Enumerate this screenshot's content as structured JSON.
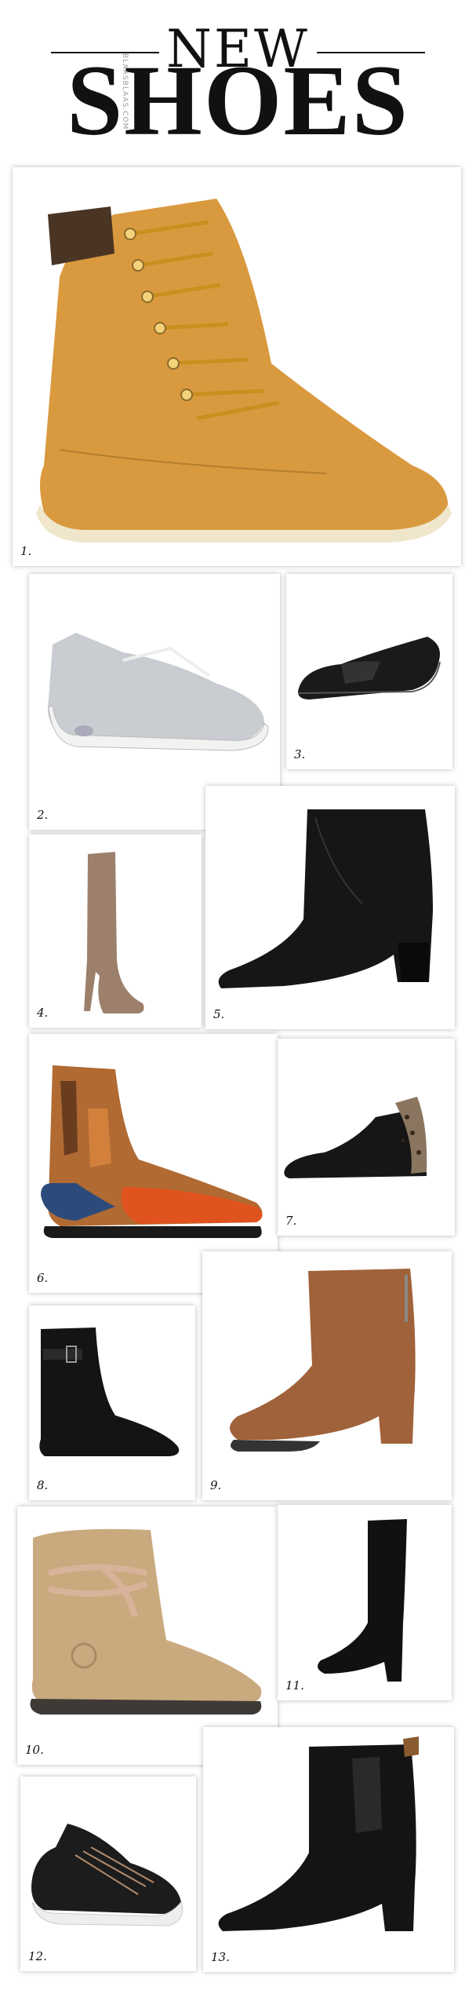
{
  "header": {
    "line1": "NEW",
    "line2": "SHOES",
    "vertical_text": "BLAASBLAAS.COM"
  },
  "items": [
    {
      "label": "1.",
      "icon": "tan-lace-up-ankle-boot-icon"
    },
    {
      "label": "2.",
      "icon": "silver-sneaker-icon"
    },
    {
      "label": "3.",
      "icon": "black-loafer-icon"
    },
    {
      "label": "4.",
      "icon": "taupe-over-knee-boot-icon"
    },
    {
      "label": "5.",
      "icon": "black-heeled-ankle-boot-icon"
    },
    {
      "label": "6.",
      "icon": "brogue-chelsea-boot-icon"
    },
    {
      "label": "7.",
      "icon": "leopard-chelsea-boot-icon"
    },
    {
      "label": "8.",
      "icon": "black-buckle-boot-icon"
    },
    {
      "label": "9.",
      "icon": "suede-block-heel-boot-icon"
    },
    {
      "label": "10.",
      "icon": "suede-winter-boot-icon"
    },
    {
      "label": "11.",
      "icon": "black-knee-boot-icon"
    },
    {
      "label": "12.",
      "icon": "black-knit-sneaker-icon"
    },
    {
      "label": "13.",
      "icon": "black-chelsea-boot-icon"
    }
  ]
}
